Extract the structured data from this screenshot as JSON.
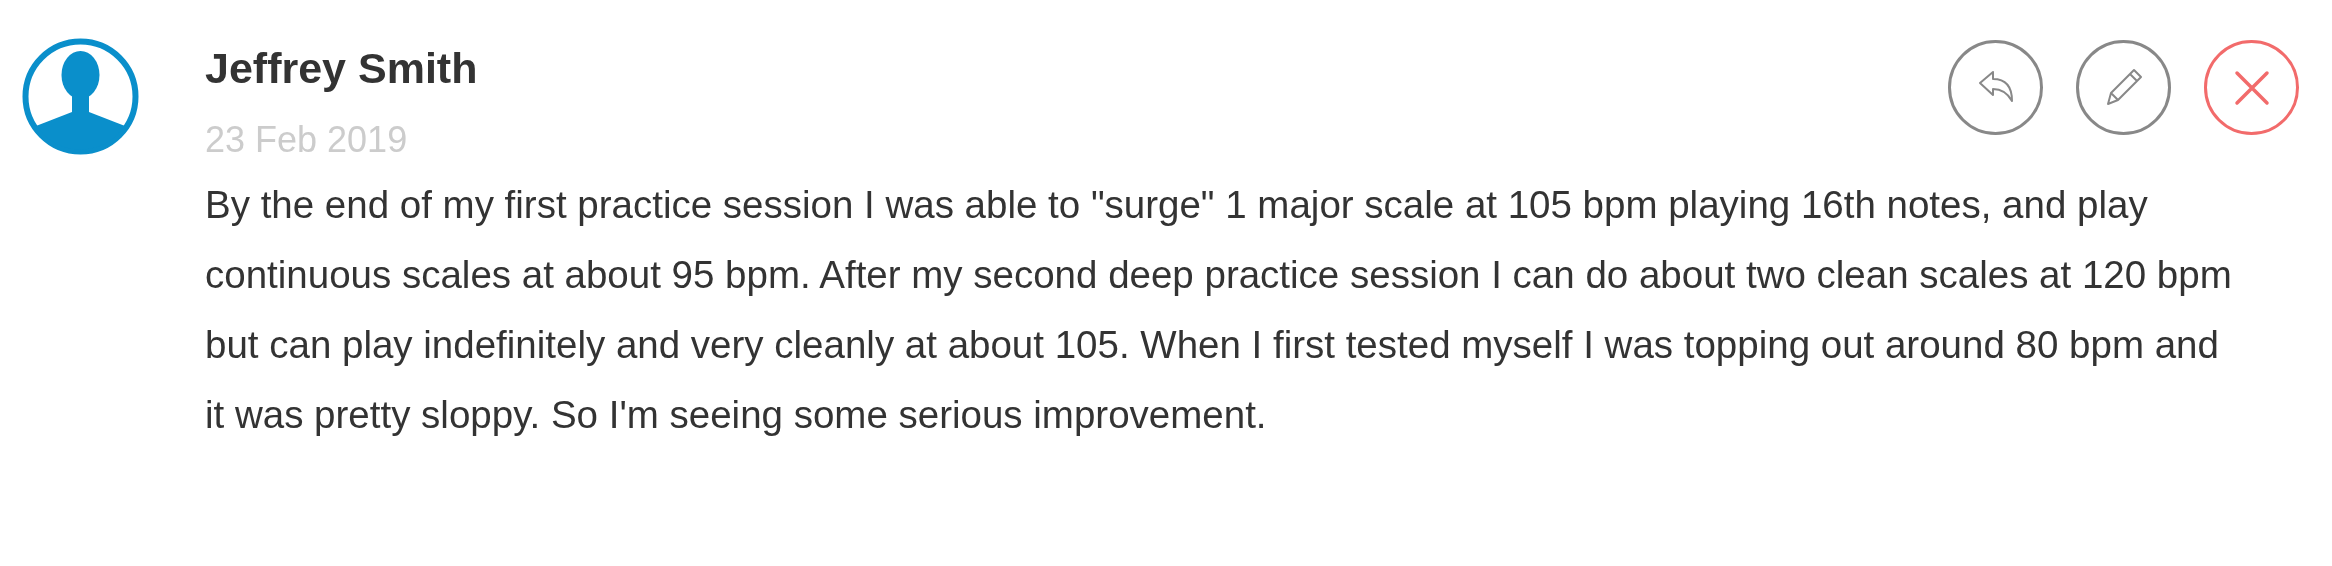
{
  "comment": {
    "author": "Jeffrey Smith",
    "date": "23 Feb 2019",
    "text": "By the end of my first practice session I was able to \"surge\" 1 major scale at 105 bpm playing 16th notes, and play continuous scales at about 95 bpm. After my second deep practice session I can do about two clean scales at 120 bpm but can play indefinitely and very cleanly at about 105. When I first tested myself I was topping out around 80 bpm and it was pretty sloppy. So I'm seeing some serious improvement."
  },
  "actions": [
    {
      "kind": "reply"
    },
    {
      "kind": "edit"
    },
    {
      "kind": "delete"
    }
  ]
}
